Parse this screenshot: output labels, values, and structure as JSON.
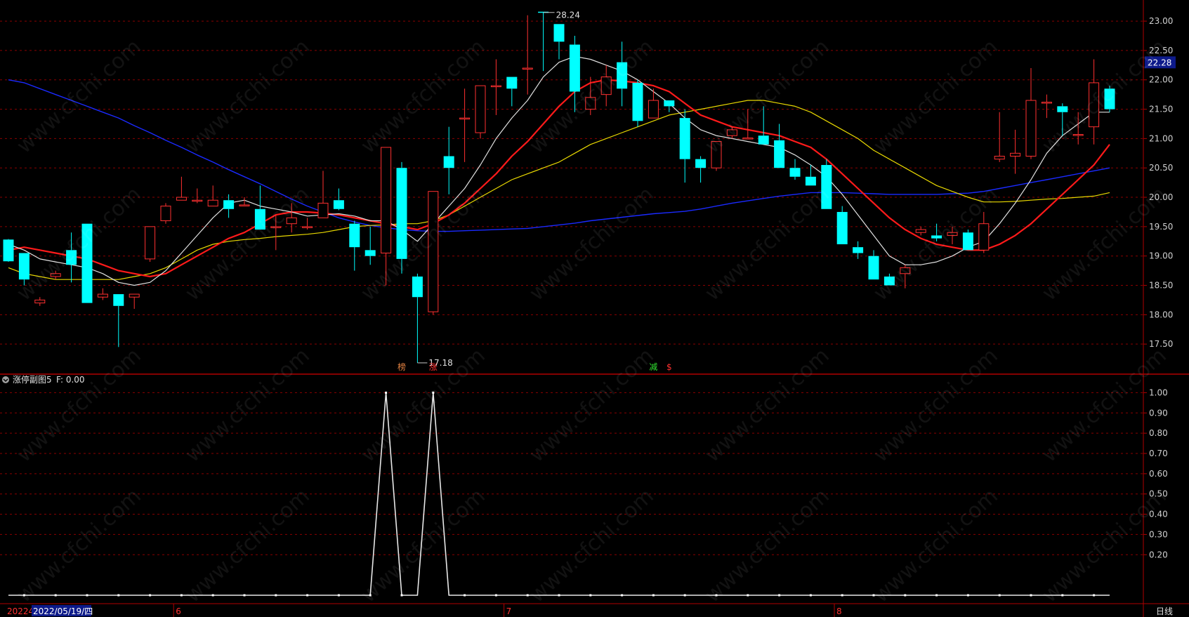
{
  "chart_data": {
    "type": "candlestick",
    "main": {
      "ylim": [
        17.0,
        23.3
      ],
      "yticks": [
        "17.50",
        "18.00",
        "18.50",
        "19.00",
        "19.50",
        "20.00",
        "20.50",
        "21.00",
        "21.50",
        "22.00",
        "22.50",
        "23.00"
      ],
      "current_price": "22.28",
      "high_label": "28.24",
      "low_label": "17.18",
      "candles": [
        [
          19.28,
          19.29,
          18.9,
          18.91
        ],
        [
          19.05,
          19.0,
          18.5,
          18.6
        ],
        [
          18.2,
          18.3,
          18.15,
          18.25
        ],
        [
          18.65,
          18.75,
          18.6,
          18.7
        ],
        [
          19.1,
          19.4,
          18.55,
          18.85
        ],
        [
          19.55,
          19.55,
          18.2,
          18.2
        ],
        [
          18.3,
          18.45,
          18.25,
          18.35
        ],
        [
          18.35,
          18.35,
          17.45,
          18.15
        ],
        [
          18.3,
          18.35,
          18.1,
          18.35
        ],
        [
          18.95,
          19.5,
          18.9,
          19.5
        ],
        [
          19.6,
          19.9,
          19.55,
          19.85
        ],
        [
          19.95,
          20.35,
          19.95,
          20.0
        ],
        [
          19.95,
          20.15,
          19.9,
          19.95
        ],
        [
          19.85,
          20.2,
          19.85,
          19.95
        ],
        [
          19.95,
          20.05,
          19.65,
          19.8
        ],
        [
          19.87,
          20.0,
          19.85,
          19.87
        ],
        [
          19.8,
          20.2,
          19.45,
          19.45
        ],
        [
          19.5,
          19.7,
          19.1,
          19.5
        ],
        [
          19.55,
          19.9,
          19.4,
          19.65
        ],
        [
          19.5,
          19.65,
          19.45,
          19.5
        ],
        [
          19.65,
          20.45,
          19.65,
          19.9
        ],
        [
          19.95,
          20.15,
          19.78,
          19.8
        ],
        [
          19.55,
          19.6,
          18.75,
          19.15
        ],
        [
          19.1,
          19.5,
          18.85,
          19.0
        ],
        [
          19.05,
          20.85,
          18.5,
          20.85
        ],
        [
          20.5,
          20.6,
          18.7,
          18.95
        ],
        [
          18.65,
          18.7,
          17.18,
          18.3
        ],
        [
          18.05,
          20.1,
          18.0,
          20.1
        ],
        [
          20.7,
          21.2,
          20.05,
          20.5
        ],
        [
          21.35,
          21.85,
          20.6,
          21.35
        ],
        [
          21.1,
          21.9,
          21.0,
          21.9
        ],
        [
          21.9,
          22.35,
          21.4,
          21.9
        ],
        [
          22.05,
          22.05,
          21.55,
          21.85
        ],
        [
          22.2,
          23.1,
          21.75,
          22.2
        ],
        [
          23.16,
          23.16,
          22.15,
          23.15
        ],
        [
          22.95,
          22.95,
          22.35,
          22.65
        ],
        [
          22.6,
          22.75,
          21.45,
          21.8
        ],
        [
          21.5,
          22.05,
          21.4,
          21.7
        ],
        [
          21.75,
          22.25,
          21.55,
          22.05
        ],
        [
          22.3,
          22.65,
          21.55,
          21.85
        ],
        [
          21.95,
          22.0,
          21.2,
          21.3
        ],
        [
          21.35,
          21.85,
          21.35,
          21.65
        ],
        [
          21.65,
          21.65,
          21.45,
          21.55
        ],
        [
          21.35,
          21.5,
          20.25,
          20.65
        ],
        [
          20.65,
          20.7,
          20.25,
          20.5
        ],
        [
          20.5,
          20.95,
          20.45,
          20.95
        ],
        [
          21.05,
          21.2,
          21.0,
          21.15
        ],
        [
          21.01,
          21.5,
          21.01,
          21.01
        ],
        [
          21.05,
          21.55,
          20.9,
          20.9
        ],
        [
          20.97,
          21.25,
          20.55,
          20.5
        ],
        [
          20.5,
          20.65,
          20.3,
          20.35
        ],
        [
          20.35,
          20.55,
          20.2,
          20.2
        ],
        [
          20.55,
          20.65,
          19.8,
          19.8
        ],
        [
          19.75,
          19.85,
          19.2,
          19.2
        ],
        [
          19.15,
          19.25,
          18.95,
          19.05
        ],
        [
          19.0,
          19.1,
          18.6,
          18.6
        ],
        [
          18.65,
          18.7,
          18.5,
          18.5
        ],
        [
          18.7,
          18.85,
          18.45,
          18.8
        ],
        [
          19.4,
          19.5,
          19.35,
          19.45
        ],
        [
          19.35,
          19.55,
          19.25,
          19.3
        ],
        [
          19.35,
          19.5,
          19.2,
          19.4
        ],
        [
          19.4,
          19.45,
          19.1,
          19.1
        ],
        [
          19.1,
          19.75,
          19.05,
          19.55
        ],
        [
          20.65,
          21.45,
          20.6,
          20.7
        ],
        [
          20.7,
          21.15,
          20.4,
          20.75
        ],
        [
          20.7,
          22.2,
          20.65,
          21.65
        ],
        [
          21.62,
          21.75,
          21.35,
          21.62
        ],
        [
          21.55,
          21.6,
          21.05,
          21.45
        ],
        [
          21.07,
          21.45,
          20.9,
          21.07
        ],
        [
          21.2,
          22.35,
          20.9,
          21.95
        ],
        [
          21.85,
          21.9,
          21.45,
          21.5
        ]
      ],
      "ma_white": [
        19.2,
        19.1,
        18.95,
        18.9,
        18.85,
        18.8,
        18.7,
        18.55,
        18.5,
        18.55,
        18.75,
        19.05,
        19.35,
        19.65,
        19.9,
        19.95,
        19.85,
        19.8,
        19.75,
        19.68,
        19.7,
        19.72,
        19.68,
        19.6,
        19.6,
        19.45,
        19.25,
        19.55,
        19.85,
        20.15,
        20.55,
        21.0,
        21.35,
        21.65,
        22.05,
        22.3,
        22.4,
        22.35,
        22.25,
        22.15,
        22.0,
        21.8,
        21.6,
        21.35,
        21.15,
        21.05,
        21.0,
        20.95,
        20.9,
        20.85,
        20.72,
        20.55,
        20.35,
        20.05,
        19.7,
        19.35,
        19.0,
        18.85,
        18.85,
        18.9,
        19.0,
        19.15,
        19.25,
        19.55,
        19.9,
        20.3,
        20.75,
        21.05,
        21.25,
        21.45,
        21.45
      ],
      "ma_red": [
        19.1,
        19.15,
        19.1,
        19.05,
        19.0,
        18.95,
        18.85,
        18.75,
        18.7,
        18.65,
        18.7,
        18.85,
        19.0,
        19.15,
        19.3,
        19.4,
        19.55,
        19.7,
        19.75,
        19.75,
        19.73,
        19.7,
        19.65,
        19.6,
        19.55,
        19.5,
        19.45,
        19.55,
        19.7,
        19.9,
        20.15,
        20.4,
        20.7,
        20.95,
        21.25,
        21.55,
        21.8,
        21.95,
        22.0,
        21.98,
        21.95,
        21.9,
        21.8,
        21.6,
        21.4,
        21.3,
        21.2,
        21.15,
        21.1,
        21.05,
        20.95,
        20.85,
        20.65,
        20.4,
        20.15,
        19.9,
        19.65,
        19.45,
        19.3,
        19.2,
        19.15,
        19.1,
        19.1,
        19.2,
        19.35,
        19.55,
        19.8,
        20.05,
        20.3,
        20.55,
        20.9
      ],
      "ma_yellow": [
        18.8,
        18.7,
        18.65,
        18.6,
        18.6,
        18.6,
        18.6,
        18.6,
        18.65,
        18.7,
        18.8,
        18.95,
        19.1,
        19.2,
        19.25,
        19.28,
        19.3,
        19.33,
        19.35,
        19.37,
        19.4,
        19.45,
        19.5,
        19.52,
        19.53,
        19.55,
        19.55,
        19.6,
        19.7,
        19.85,
        20.0,
        20.15,
        20.3,
        20.4,
        20.5,
        20.6,
        20.75,
        20.9,
        21.0,
        21.1,
        21.2,
        21.3,
        21.4,
        21.45,
        21.5,
        21.55,
        21.6,
        21.65,
        21.65,
        21.6,
        21.55,
        21.45,
        21.3,
        21.15,
        21.0,
        20.8,
        20.65,
        20.5,
        20.35,
        20.2,
        20.1,
        20.0,
        19.92,
        19.92,
        19.93,
        19.95,
        19.97,
        19.98,
        20.0,
        20.02,
        20.08
      ],
      "ma_blue": [
        22.0,
        21.95,
        21.85,
        21.75,
        21.65,
        21.55,
        21.45,
        21.35,
        21.22,
        21.1,
        20.97,
        20.85,
        20.72,
        20.6,
        20.47,
        20.35,
        20.23,
        20.1,
        19.97,
        19.85,
        19.75,
        19.65,
        19.58,
        19.52,
        19.48,
        19.45,
        19.43,
        19.42,
        19.42,
        19.43,
        19.44,
        19.45,
        19.46,
        19.47,
        19.5,
        19.53,
        19.56,
        19.6,
        19.63,
        19.66,
        19.69,
        19.72,
        19.74,
        19.76,
        19.8,
        19.85,
        19.9,
        19.94,
        19.98,
        20.02,
        20.05,
        20.08,
        20.08,
        20.08,
        20.07,
        20.06,
        20.05,
        20.05,
        20.05,
        20.05,
        20.06,
        20.07,
        20.1,
        20.15,
        20.2,
        20.25,
        20.3,
        20.35,
        20.4,
        20.45,
        20.5
      ],
      "markers": [
        {
          "index": 25,
          "text": "榜",
          "color": "#e08040"
        },
        {
          "index": 27,
          "text": "涨",
          "color": "#ff3030"
        },
        {
          "index": 41,
          "text": "减",
          "color": "#30e030"
        },
        {
          "index": 42,
          "text": "$",
          "color": "#ff3030"
        }
      ]
    },
    "indicator": {
      "title": "涨停副图5",
      "value_label": "F: 0.00",
      "ylim": [
        0,
        1.05
      ],
      "yticks": [
        "0.20",
        "0.30",
        "0.40",
        "0.50",
        "0.60",
        "0.70",
        "0.80",
        "0.90",
        "1.00"
      ],
      "values": [
        0,
        0,
        0,
        0,
        0,
        0,
        0,
        0,
        0,
        0,
        0,
        0,
        0,
        0,
        0,
        0,
        0,
        0,
        0,
        0,
        0,
        0,
        0,
        0,
        1,
        0,
        0,
        1,
        0,
        0,
        0,
        0,
        0,
        0,
        0,
        0,
        0,
        0,
        0,
        0,
        0,
        0,
        0,
        0,
        0,
        0,
        0,
        0,
        0,
        0,
        0,
        0,
        0,
        0,
        0,
        0,
        0,
        0,
        0,
        0,
        0,
        0,
        0,
        0,
        0,
        0,
        0,
        0,
        0,
        0,
        0
      ]
    },
    "x_axis": {
      "start_label": "20224",
      "cursor_label": "2022/05/19/四",
      "month_ticks": [
        {
          "index": 11,
          "label": "6"
        },
        {
          "index": 32,
          "label": "7"
        },
        {
          "index": 53,
          "label": "8"
        }
      ],
      "period_label": "日线"
    }
  },
  "watermark": "www.cfchi.com",
  "colors": {
    "up": "#ff3030",
    "down": "#00ffff",
    "grid": "#8b0000",
    "frame": "#b00000",
    "ma_white": "#e0e0e0",
    "ma_red": "#ff1a1a",
    "ma_yellow": "#e8d800",
    "ma_blue": "#1a2aff"
  }
}
